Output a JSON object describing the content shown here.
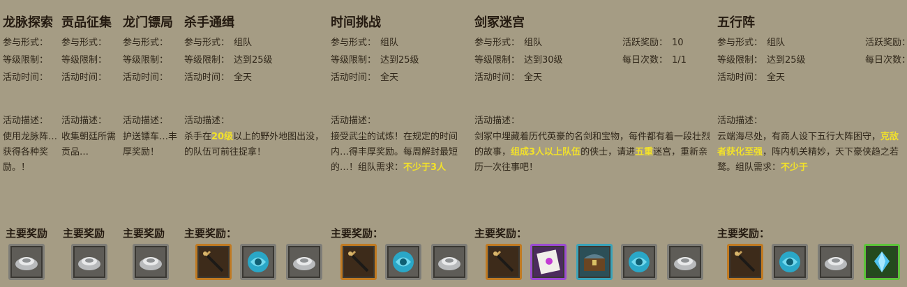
{
  "panels": [
    {
      "title": "龙脉探索",
      "rows": [
        {
          "k": "参与形式：",
          "v": ""
        },
        {
          "k": "等级限制：",
          "v": ""
        },
        {
          "k": "活动时间：",
          "v": ""
        }
      ],
      "desc_label": "活动描述：",
      "desc_parts": [
        {
          "t": "使用龙脉阵…获得各种奖励。"
        },
        {
          "t": "！"
        }
      ],
      "reward_label": "主要奖励",
      "rewards": [
        {
          "icon": "silver-ingot-icon",
          "frame": "gray"
        }
      ]
    },
    {
      "title": "贡品征集",
      "rows": [
        {
          "k": "参与形式：",
          "v": ""
        },
        {
          "k": "等级限制：",
          "v": ""
        },
        {
          "k": "活动时间：",
          "v": ""
        }
      ],
      "desc_label": "活动描述：",
      "desc_parts": [
        {
          "t": "收集朝廷所需贡品…"
        }
      ],
      "reward_label": "主要奖励",
      "rewards": [
        {
          "icon": "silver-ingot-icon",
          "frame": "gray"
        }
      ]
    },
    {
      "title": "龙门镖局",
      "rows": [
        {
          "k": "参与形式：",
          "v": ""
        },
        {
          "k": "等级限制：",
          "v": ""
        },
        {
          "k": "活动时间：",
          "v": ""
        }
      ],
      "desc_label": "活动描述：",
      "desc_parts": [
        {
          "t": "护送镖车…丰厚奖励！"
        }
      ],
      "reward_label": "主要奖励",
      "rewards": [
        {
          "icon": "silver-ingot-icon",
          "frame": "gray"
        }
      ]
    },
    {
      "title": "杀手通缉",
      "rows": [
        {
          "k": "参与形式：",
          "v": "组队"
        },
        {
          "k": "等级限制：",
          "v": "达到25级"
        },
        {
          "k": "活动时间：",
          "v": "全天"
        }
      ],
      "desc_label": "活动描述：",
      "desc_parts": [
        {
          "t": "杀手在"
        },
        {
          "t": "20级",
          "hl": true
        },
        {
          "t": "以上的野外地图出没，"
        },
        {
          "t": "的队伍可前往捉拿！"
        }
      ],
      "reward_label": "主要奖励：",
      "rewards": [
        {
          "icon": "sword-icon",
          "frame": "orange"
        },
        {
          "icon": "blue-orb-icon",
          "frame": "gray"
        },
        {
          "icon": "silver-ingot-icon",
          "frame": "gray"
        }
      ]
    },
    {
      "title": "时间挑战",
      "rows": [
        {
          "k": "参与形式：",
          "v": "组队"
        },
        {
          "k": "等级限制：",
          "v": "达到25级"
        },
        {
          "k": "活动时间：",
          "v": "全天"
        }
      ],
      "desc_label": "活动描述：",
      "desc_parts": [
        {
          "t": "接受武尘的试炼！在规定的时间内…"
        },
        {
          "t": "得丰厚奖励。每周解封最短的…"
        },
        {
          "t": "！组队需求："
        },
        {
          "t": "不少于3人",
          "hl": true
        }
      ],
      "reward_label": "主要奖励：",
      "rewards": [
        {
          "icon": "sword-icon",
          "frame": "orange"
        },
        {
          "icon": "blue-orb-icon",
          "frame": "gray"
        },
        {
          "icon": "silver-ingot-icon",
          "frame": "gray"
        }
      ]
    },
    {
      "title": "剑冢迷宫",
      "rows": [
        {
          "k": "参与形式：",
          "v": "组队",
          "k2": "活跃奖励：",
          "v2": "10"
        },
        {
          "k": "等级限制：",
          "v": "达到30级",
          "k2": "每日次数：",
          "v2": "1/1"
        },
        {
          "k": "活动时间：",
          "v": "全天"
        }
      ],
      "desc_label": "活动描述：",
      "desc_parts": [
        {
          "t": "剑冢中埋藏着历代英豪的名剑和宝物，每件都有着一"
        },
        {
          "t": "段壮烈的故事，"
        },
        {
          "t": "组成3人以上队伍",
          "hl": true
        },
        {
          "t": "的侠士，请进"
        },
        {
          "t": "五重",
          "hl": true
        },
        {
          "t": "迷宫，重新亲历一次往事吧！"
        }
      ],
      "reward_label": "主要奖励：",
      "rewards": [
        {
          "icon": "sword-icon",
          "frame": "orange"
        },
        {
          "icon": "scroll-book-icon",
          "frame": "purple"
        },
        {
          "icon": "treasure-chest-icon",
          "frame": "teal"
        },
        {
          "icon": "blue-orb-icon",
          "frame": "gray"
        },
        {
          "icon": "silver-ingot-icon",
          "frame": "gray"
        }
      ]
    },
    {
      "title": "五行阵",
      "rows": [
        {
          "k": "参与形式：",
          "v": "组队",
          "k2": "活跃奖励：",
          "v2": ""
        },
        {
          "k": "等级限制：",
          "v": "达到25级",
          "k2": "每日次数：",
          "v2": ""
        },
        {
          "k": "活动时间：",
          "v": "全天"
        }
      ],
      "desc_label": "活动描述：",
      "desc_parts": [
        {
          "t": "云端海尽处，有商人设下五行大阵困守，"
        },
        {
          "t": "克敌者获化至强",
          "hl": true
        },
        {
          "t": "，阵内机关精妙，"
        },
        {
          "t": "天下豪侠趋之若鹜。组队需求："
        },
        {
          "t": "不少于",
          "hl": true
        }
      ],
      "reward_label": "主要奖励：",
      "rewards": [
        {
          "icon": "sword-icon",
          "frame": "orange"
        },
        {
          "icon": "blue-orb-icon",
          "frame": "gray"
        },
        {
          "icon": "silver-ingot-icon",
          "frame": "gray"
        },
        {
          "icon": "blue-crystal-icon",
          "frame": "green"
        }
      ]
    }
  ]
}
